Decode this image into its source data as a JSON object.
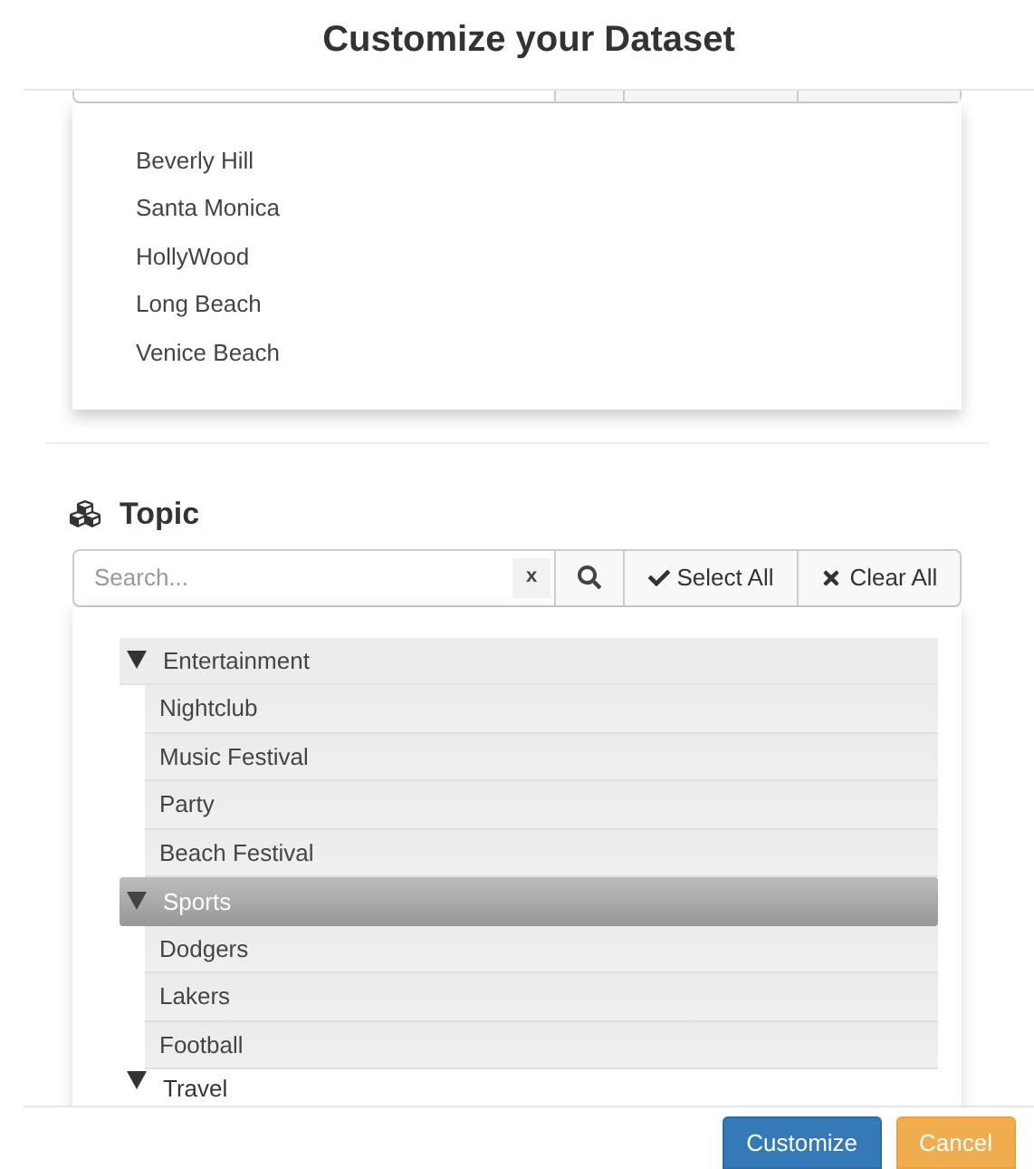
{
  "title": "Customize your Dataset",
  "locations": [
    "Beverly Hill",
    "Santa Monica",
    "HollyWood",
    "Long Beach",
    "Venice Beach"
  ],
  "topic": {
    "heading": "Topic",
    "search": {
      "placeholder": "Search...",
      "clear": "x"
    },
    "select_all": "Select All",
    "clear_all": "Clear All",
    "tree": [
      {
        "label": "Entertainment",
        "selected": false,
        "shaded": true,
        "expanded": true,
        "children": [
          {
            "label": "Nightclub"
          },
          {
            "label": "Music Festival"
          },
          {
            "label": "Party"
          },
          {
            "label": "Beach Festival"
          }
        ]
      },
      {
        "label": "Sports",
        "selected": true,
        "expanded": true,
        "children": [
          {
            "label": "Dodgers"
          },
          {
            "label": "Lakers"
          },
          {
            "label": "Football"
          }
        ]
      },
      {
        "label": "Travel",
        "selected": false,
        "shaded": false,
        "expanded": true
      }
    ]
  },
  "buttons": [
    {
      "label": "Customize",
      "kind": "primary"
    },
    {
      "label": "Cancel",
      "kind": "warning"
    }
  ]
}
